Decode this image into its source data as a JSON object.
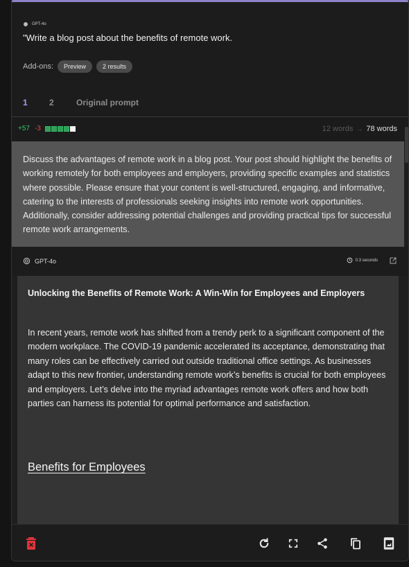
{
  "header": {
    "model_tiny": "GPT-4o",
    "prompt": "\"Write a blog post about the benefits of remote work.",
    "addons_label": "Add-ons:",
    "pills": [
      "Preview",
      "2 results"
    ]
  },
  "tabs": [
    "1",
    "2",
    "Original prompt"
  ],
  "diff": {
    "plus": "+57",
    "minus": "-3",
    "old_words": "12 words",
    "arrow": "→",
    "new_words": "78 words"
  },
  "rewritten_prompt": "Discuss the advantages of remote work in a blog post. Your post should highlight the benefits of working remotely for both employees and employers, providing specific examples and statistics where possible. Please ensure that your content is well-structured, engaging, and informative, catering to the interests of professionals seeking insights into remote work opportunities. Additionally, consider addressing potential challenges and providing practical tips for successful remote work arrangements.",
  "response": {
    "model": "GPT-4o",
    "time": "0.3 seconds",
    "title": "Unlocking the Benefits of Remote Work: A Win-Win for Employees and Employers",
    "paragraph": "In recent years, remote work has shifted from a trendy perk to a significant component of the modern workplace. The COVID-19 pandemic accelerated its acceptance, demonstrating that many roles can be effectively carried out outside traditional office settings. As businesses adapt to this new frontier, understanding remote work’s benefits is crucial for both employees and employers. Let’s delve into the myriad advantages remote work offers and how both parties can harness its potential for optimal performance and satisfaction.",
    "heading": "Benefits for Employees"
  },
  "icons": {
    "delete": "trash-icon",
    "regenerate": "refresh-icon",
    "fullscreen": "fullscreen-icon",
    "share": "share-icon",
    "copy": "copy-icon",
    "copy_image": "copy-image-icon"
  },
  "colors": {
    "accent": "#9a8cf0",
    "positive": "#35c46a",
    "negative": "#e04b4b",
    "delete": "#e0343a"
  }
}
